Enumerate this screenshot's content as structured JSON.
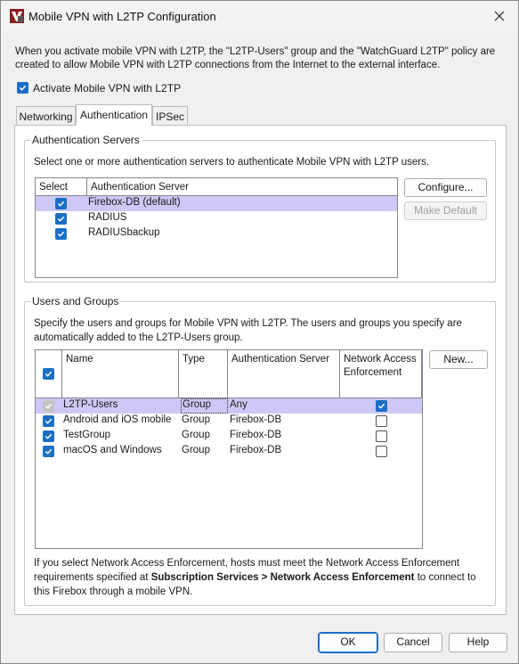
{
  "window": {
    "title": "Mobile VPN with L2TP Configuration"
  },
  "intro_text": "When you activate mobile VPN with L2TP, the \"L2TP-Users\" group and the \"WatchGuard L2TP\" policy are created to allow Mobile VPN with L2TP connections from the Internet to the external interface.",
  "activate": {
    "label": "Activate Mobile VPN with L2TP",
    "checked": true
  },
  "tabs": [
    {
      "label": "Networking",
      "active": false
    },
    {
      "label": "Authentication",
      "active": true
    },
    {
      "label": "IPSec",
      "active": false
    }
  ],
  "auth_servers": {
    "group_title": "Authentication Servers",
    "description": "Select one or more authentication servers to authenticate Mobile VPN with L2TP users.",
    "columns": [
      "Select",
      "Authentication Server"
    ],
    "rows": [
      {
        "checked": true,
        "name": "Firebox-DB  (default)",
        "selected": true
      },
      {
        "checked": true,
        "name": "RADIUS",
        "selected": false
      },
      {
        "checked": true,
        "name": "RADIUSbackup",
        "selected": false
      }
    ],
    "configure_label": "Configure...",
    "make_default_label": "Make Default"
  },
  "users_groups": {
    "group_title": "Users and Groups",
    "description": "Specify the users and groups for Mobile VPN with L2TP. The users and groups you specify are automatically added to the L2TP-Users group.",
    "columns": [
      "Name",
      "Type",
      "Authentication Server",
      "Network Access Enforcement"
    ],
    "rows": [
      {
        "checked": true,
        "disabled": true,
        "name": "L2TP-Users",
        "type": "Group",
        "server": "Any",
        "nae": true,
        "selected": true
      },
      {
        "checked": true,
        "disabled": false,
        "name": "Android and iOS mobile",
        "type": "Group",
        "server": "Firebox-DB",
        "nae": false,
        "selected": false
      },
      {
        "checked": true,
        "disabled": false,
        "name": "TestGroup",
        "type": "Group",
        "server": "Firebox-DB",
        "nae": false,
        "selected": false
      },
      {
        "checked": true,
        "disabled": false,
        "name": "macOS and Windows",
        "type": "Group",
        "server": "Firebox-DB",
        "nae": false,
        "selected": false
      }
    ],
    "new_label": "New...",
    "note_part1": "If you select Network Access Enforcement, hosts must meet the Network Access Enforcement requirements specified at ",
    "note_bold": "Subscription Services > Network Access Enforcement",
    "note_part2": " to connect to this Firebox through a mobile VPN."
  },
  "footer": {
    "ok_label": "OK",
    "cancel_label": "Cancel",
    "help_label": "Help"
  },
  "colors": {
    "accent": "#1d6fc4",
    "selection": "#cdc8f5"
  }
}
